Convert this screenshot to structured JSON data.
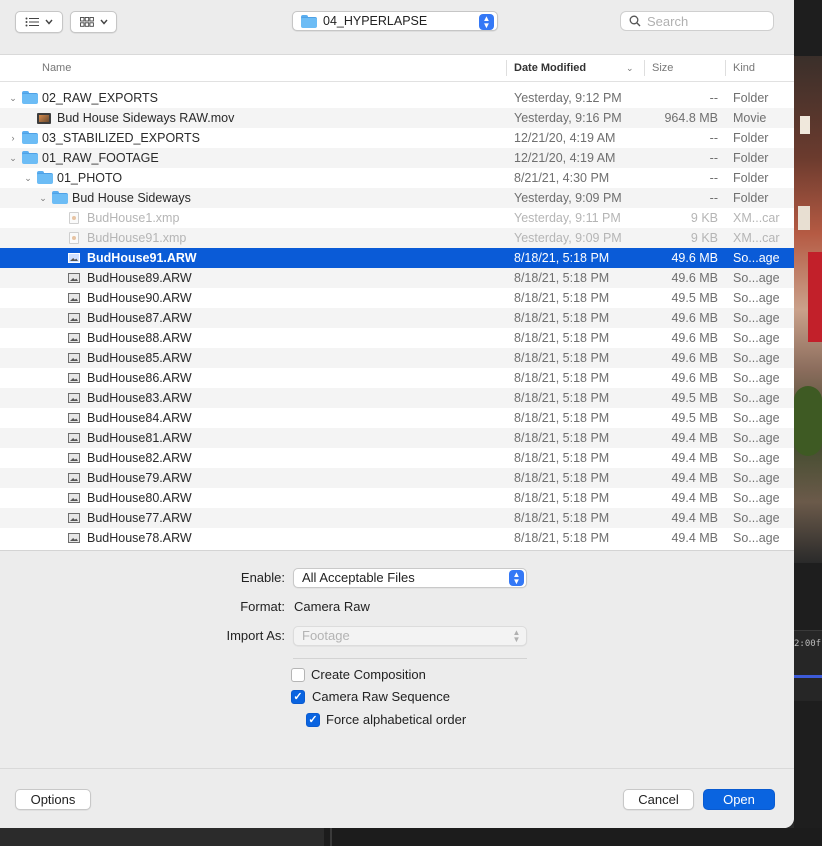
{
  "toolbar": {
    "path_folder": "04_HYPERLAPSE",
    "search_placeholder": "Search"
  },
  "columns": {
    "name": "Name",
    "date": "Date Modified",
    "size": "Size",
    "kind": "Kind"
  },
  "rows": [
    {
      "name": "02_RAW_EXPORTS",
      "date": "Yesterday, 9:12 PM",
      "size": "--",
      "kind": "Folder"
    },
    {
      "name": "Bud House Sideways RAW.mov",
      "date": "Yesterday, 9:16 PM",
      "size": "964.8 MB",
      "kind": "Movie"
    },
    {
      "name": "03_STABILIZED_EXPORTS",
      "date": "12/21/20, 4:19 AM",
      "size": "--",
      "kind": "Folder"
    },
    {
      "name": "01_RAW_FOOTAGE",
      "date": "12/21/20, 4:19 AM",
      "size": "--",
      "kind": "Folder"
    },
    {
      "name": "01_PHOTO",
      "date": "8/21/21, 4:30 PM",
      "size": "--",
      "kind": "Folder"
    },
    {
      "name": "Bud House Sideways",
      "date": "Yesterday, 9:09 PM",
      "size": "--",
      "kind": "Folder"
    },
    {
      "name": "BudHouse1.xmp",
      "date": "Yesterday, 9:11 PM",
      "size": "9 KB",
      "kind": "XM...car"
    },
    {
      "name": "BudHouse91.xmp",
      "date": "Yesterday, 9:09 PM",
      "size": "9 KB",
      "kind": "XM...car"
    },
    {
      "name": "BudHouse91.ARW",
      "date": "8/18/21, 5:18 PM",
      "size": "49.6 MB",
      "kind": "So...age"
    },
    {
      "name": "BudHouse89.ARW",
      "date": "8/18/21, 5:18 PM",
      "size": "49.6 MB",
      "kind": "So...age"
    },
    {
      "name": "BudHouse90.ARW",
      "date": "8/18/21, 5:18 PM",
      "size": "49.5 MB",
      "kind": "So...age"
    },
    {
      "name": "BudHouse87.ARW",
      "date": "8/18/21, 5:18 PM",
      "size": "49.6 MB",
      "kind": "So...age"
    },
    {
      "name": "BudHouse88.ARW",
      "date": "8/18/21, 5:18 PM",
      "size": "49.6 MB",
      "kind": "So...age"
    },
    {
      "name": "BudHouse85.ARW",
      "date": "8/18/21, 5:18 PM",
      "size": "49.6 MB",
      "kind": "So...age"
    },
    {
      "name": "BudHouse86.ARW",
      "date": "8/18/21, 5:18 PM",
      "size": "49.6 MB",
      "kind": "So...age"
    },
    {
      "name": "BudHouse83.ARW",
      "date": "8/18/21, 5:18 PM",
      "size": "49.5 MB",
      "kind": "So...age"
    },
    {
      "name": "BudHouse84.ARW",
      "date": "8/18/21, 5:18 PM",
      "size": "49.5 MB",
      "kind": "So...age"
    },
    {
      "name": "BudHouse81.ARW",
      "date": "8/18/21, 5:18 PM",
      "size": "49.4 MB",
      "kind": "So...age"
    },
    {
      "name": "BudHouse82.ARW",
      "date": "8/18/21, 5:18 PM",
      "size": "49.4 MB",
      "kind": "So...age"
    },
    {
      "name": "BudHouse79.ARW",
      "date": "8/18/21, 5:18 PM",
      "size": "49.4 MB",
      "kind": "So...age"
    },
    {
      "name": "BudHouse80.ARW",
      "date": "8/18/21, 5:18 PM",
      "size": "49.4 MB",
      "kind": "So...age"
    },
    {
      "name": "BudHouse77.ARW",
      "date": "8/18/21, 5:18 PM",
      "size": "49.4 MB",
      "kind": "So...age"
    },
    {
      "name": "BudHouse78.ARW",
      "date": "8/18/21, 5:18 PM",
      "size": "49.4 MB",
      "kind": "So...age"
    }
  ],
  "options": {
    "enable_label": "Enable:",
    "enable_value": "All Acceptable Files",
    "format_label": "Format:",
    "format_value": "Camera Raw",
    "import_as_label": "Import As:",
    "import_as_value": "Footage",
    "create_composition": "Create Composition",
    "camera_raw_sequence": "Camera Raw Sequence",
    "force_alphabetical": "Force alphabetical order"
  },
  "footer": {
    "options": "Options",
    "cancel": "Cancel",
    "open": "Open"
  },
  "background": {
    "timecode": "2:00f"
  }
}
